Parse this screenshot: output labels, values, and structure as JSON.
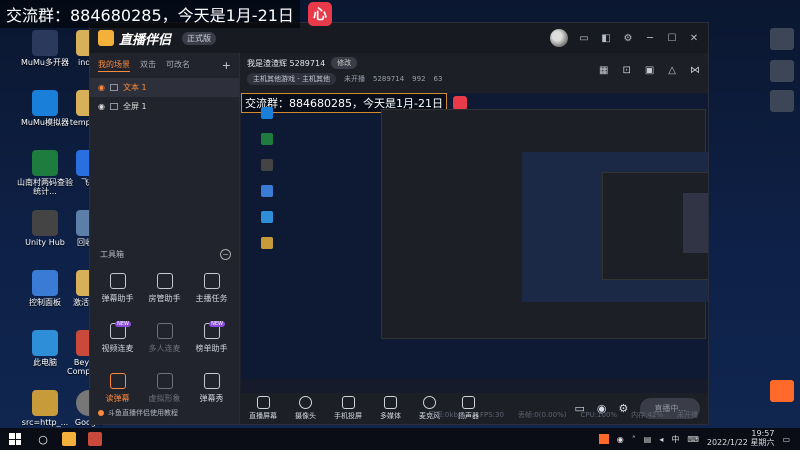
{
  "overlay": {
    "banner_text": "交流群：884680285，今天是1月-21日",
    "logo_char": "心"
  },
  "desktop_icons_left": [
    {
      "label": "MuMu多开器",
      "color": "#2b3a5c"
    },
    {
      "label": "MuMu模拟器",
      "color": "#1a7fd8"
    },
    {
      "label": "山南村两码查验统计...",
      "color": "#1e7c3f"
    },
    {
      "label": "Unity Hub",
      "color": "#444"
    },
    {
      "label": "控制面板",
      "color": "#3a7bd5"
    },
    {
      "label": "此电脑",
      "color": "#2e8fd8"
    },
    {
      "label": "src=http_...",
      "color": "#c89b3a"
    }
  ],
  "desktop_icons_col2": [
    {
      "label": "index",
      "color": "#d8b05a"
    },
    {
      "label": "temp-vue",
      "color": "#d8b05a"
    },
    {
      "label": "飞书",
      "color": "#2a6fe0"
    },
    {
      "label": "回收站",
      "color": "#5b7fa6"
    },
    {
      "label": "激活工具",
      "color": "#d8b05a"
    },
    {
      "label": "Beyond Compare 4",
      "color": "#c94a3a"
    },
    {
      "label": "Google Earth Pro",
      "color": "#777"
    }
  ],
  "app": {
    "name": "直播伴侣",
    "version_badge": "正式版",
    "tabs": [
      "我的场景",
      "双击",
      "可改名"
    ],
    "scenes": [
      {
        "label": "文本 1",
        "selected": true
      },
      {
        "label": "全屏 1",
        "selected": false
      }
    ],
    "tools_title": "工具箱",
    "tools": [
      {
        "label": "弹幕助手",
        "state": "normal",
        "badge": ""
      },
      {
        "label": "房管助手",
        "state": "normal",
        "badge": ""
      },
      {
        "label": "主播任务",
        "state": "normal",
        "badge": ""
      },
      {
        "label": "视频连麦",
        "state": "normal",
        "badge": "NEW"
      },
      {
        "label": "多人连麦",
        "state": "dim",
        "badge": ""
      },
      {
        "label": "榜单助手",
        "state": "normal",
        "badge": "NEW"
      },
      {
        "label": "读弹幕",
        "state": "orange",
        "badge": ""
      },
      {
        "label": "虚拟形象",
        "state": "dim",
        "badge": ""
      },
      {
        "label": "弹幕秀",
        "state": "normal",
        "badge": ""
      }
    ],
    "help_text": "斗鱼直播伴侣使用教程",
    "room": {
      "title": "我是渣渣辉 5289714",
      "edit_label": "修改",
      "category": "主机其他游戏 - 主机其他",
      "status": "未开播",
      "room_id": "5289714",
      "fans": "992",
      "followers": "63"
    },
    "preview_banner": "交流群：884680285，今天是1月-21日",
    "bottom_tools": [
      "直播屏幕",
      "摄像头",
      "手机投屏",
      "多媒体",
      "麦克风",
      "扬声器"
    ],
    "go_live": "直播中...",
    "status": {
      "bitrate": "码率:0kbps",
      "fps": "FPS:30",
      "dropped": "丢帧:0(0.00%)",
      "cpu": "CPU:100%",
      "memory": "内存:42%",
      "disk": "未开播"
    }
  },
  "taskbar": {
    "tray_ime": "中",
    "time": "19:57",
    "date": "2022/1/22 星期六"
  }
}
